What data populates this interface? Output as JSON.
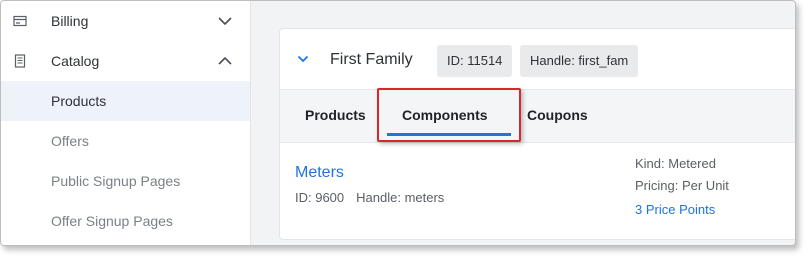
{
  "sidebar": {
    "groups": [
      {
        "label": "Billing",
        "icon": "billing-icon",
        "expanded": false
      },
      {
        "label": "Catalog",
        "icon": "catalog-icon",
        "expanded": true
      }
    ],
    "items": [
      {
        "label": "Products",
        "active": true
      },
      {
        "label": "Offers",
        "active": false
      },
      {
        "label": "Public Signup Pages",
        "active": false
      },
      {
        "label": "Offer Signup Pages",
        "active": false
      }
    ]
  },
  "family": {
    "name": "First Family",
    "id_badge": "ID: 11514",
    "handle_badge": "Handle: first_fam"
  },
  "tabs": [
    {
      "label": "Products"
    },
    {
      "label": "Components",
      "active": true
    },
    {
      "label": "Coupons"
    }
  ],
  "component": {
    "name": "Meters",
    "id": "ID: 9600",
    "handle": "Handle: meters",
    "kind": "Kind: Metered",
    "pricing": "Pricing: Per Unit",
    "price_points": "3 Price Points"
  },
  "colors": {
    "accent": "#1e73e6",
    "highlight": "#d9262b",
    "active_nav_bg": "#eef2f9"
  }
}
